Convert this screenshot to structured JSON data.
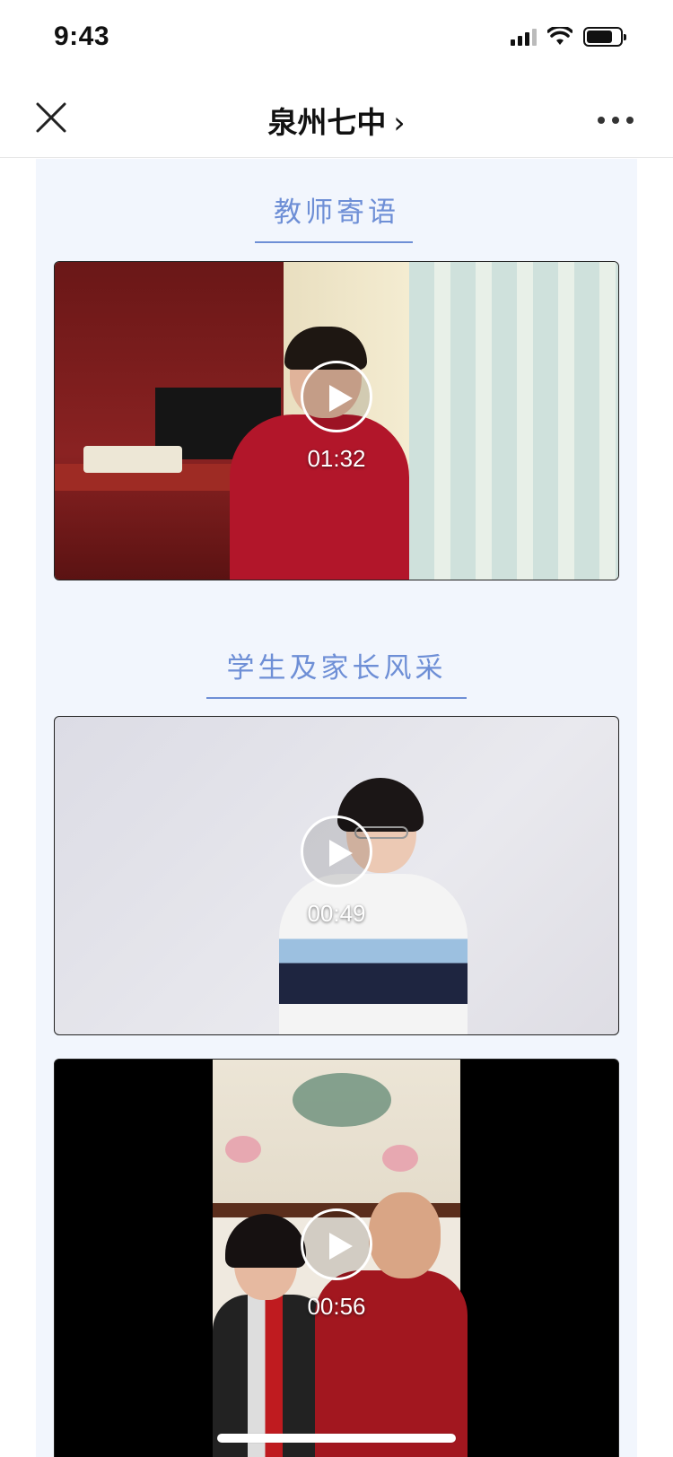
{
  "status_bar": {
    "time": "9:43",
    "icons": [
      "signal-icon",
      "wifi-icon",
      "battery-icon"
    ]
  },
  "nav": {
    "title": "泉州七中",
    "title_chevron": "›",
    "close_icon": "close-icon",
    "more_icon": "more-icon"
  },
  "sections": [
    {
      "title": "教师寄语",
      "videos": [
        {
          "duration": "01:32"
        }
      ]
    },
    {
      "title": "学生及家长风采",
      "videos": [
        {
          "duration": "00:49"
        },
        {
          "duration": "00:56"
        }
      ]
    }
  ],
  "colors": {
    "accent": "#6e8fd6",
    "content_bg": "#f2f6fd"
  }
}
